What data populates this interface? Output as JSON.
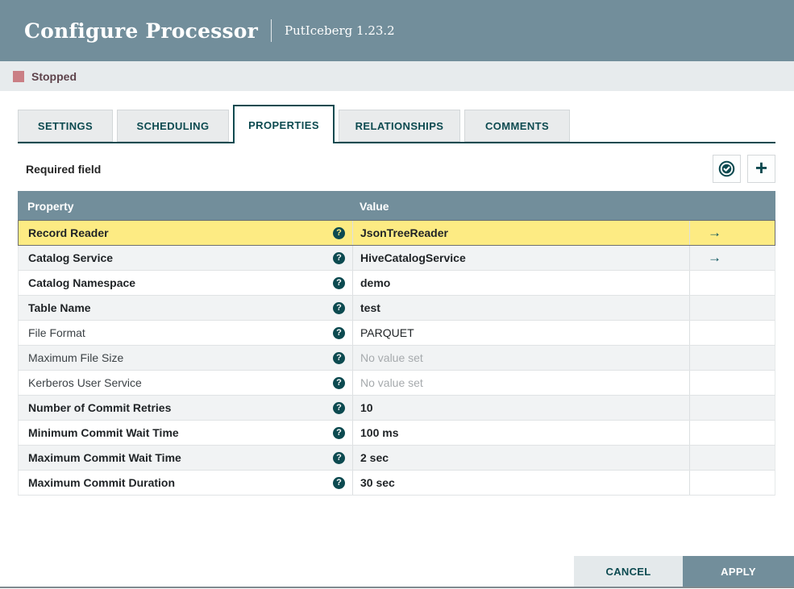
{
  "colors": {
    "header_bg": "#728e9b",
    "accent_teal": "#0c4a50",
    "selected_row": "#fdeb83",
    "stopped_indicator": "#ca7f85"
  },
  "dialog": {
    "title": "Configure Processor",
    "processor": "PutIceberg 1.23.2"
  },
  "status": {
    "label": "Stopped"
  },
  "tabs": [
    {
      "label": "SETTINGS",
      "active": false
    },
    {
      "label": "SCHEDULING",
      "active": false
    },
    {
      "label": "PROPERTIES",
      "active": true
    },
    {
      "label": "RELATIONSHIPS",
      "active": false
    },
    {
      "label": "COMMENTS",
      "active": false
    }
  ],
  "toolbar": {
    "required_label": "Required field"
  },
  "icons": {
    "help": "?",
    "goto_arrow": "→",
    "plus": "+"
  },
  "table": {
    "columns": [
      "Property",
      "Value"
    ],
    "rows": [
      {
        "property": "Record Reader",
        "value": "JsonTreeReader",
        "required": true,
        "value_set": true,
        "selected": true,
        "has_goto": true
      },
      {
        "property": "Catalog Service",
        "value": "HiveCatalogService",
        "required": true,
        "value_set": true,
        "selected": false,
        "has_goto": true
      },
      {
        "property": "Catalog Namespace",
        "value": "demo",
        "required": true,
        "value_set": true,
        "selected": false,
        "has_goto": false
      },
      {
        "property": "Table Name",
        "value": "test",
        "required": true,
        "value_set": true,
        "selected": false,
        "has_goto": false
      },
      {
        "property": "File Format",
        "value": "PARQUET",
        "required": false,
        "value_set": true,
        "selected": false,
        "has_goto": false
      },
      {
        "property": "Maximum File Size",
        "value": "No value set",
        "required": false,
        "value_set": false,
        "selected": false,
        "has_goto": false
      },
      {
        "property": "Kerberos User Service",
        "value": "No value set",
        "required": false,
        "value_set": false,
        "selected": false,
        "has_goto": false
      },
      {
        "property": "Number of Commit Retries",
        "value": "10",
        "required": true,
        "value_set": true,
        "selected": false,
        "has_goto": false
      },
      {
        "property": "Minimum Commit Wait Time",
        "value": "100 ms",
        "required": true,
        "value_set": true,
        "selected": false,
        "has_goto": false
      },
      {
        "property": "Maximum Commit Wait Time",
        "value": "2 sec",
        "required": true,
        "value_set": true,
        "selected": false,
        "has_goto": false
      },
      {
        "property": "Maximum Commit Duration",
        "value": "30 sec",
        "required": true,
        "value_set": true,
        "selected": false,
        "has_goto": false
      }
    ]
  },
  "footer": {
    "cancel_label": "CANCEL",
    "apply_label": "APPLY"
  }
}
